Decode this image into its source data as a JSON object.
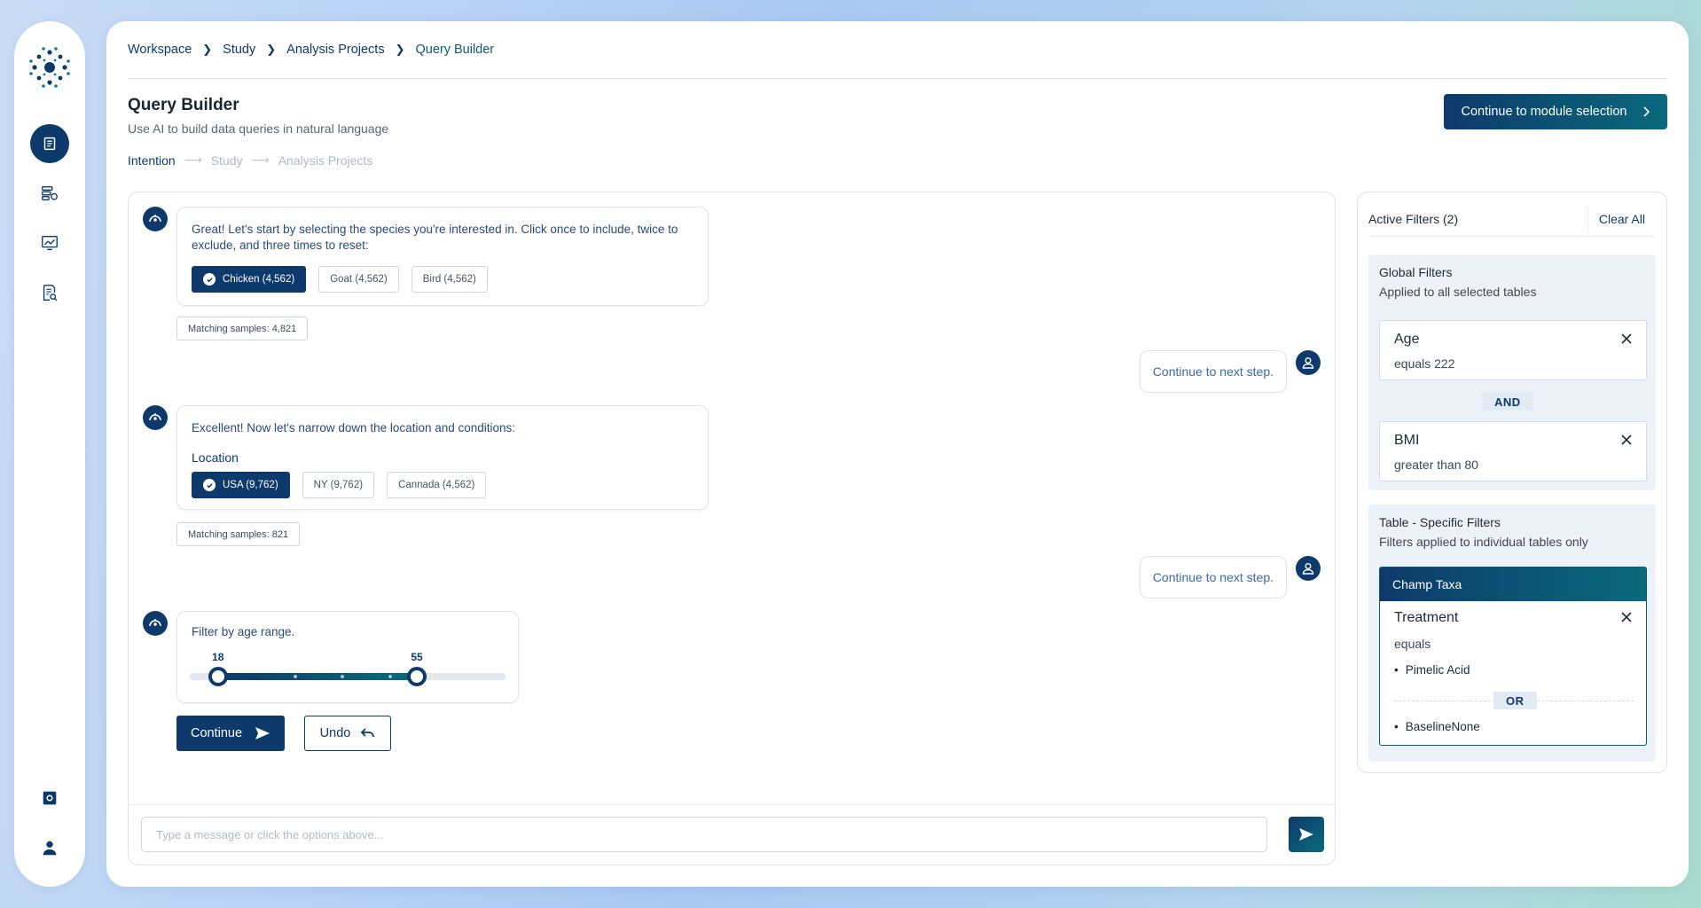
{
  "breadcrumb": [
    "Workspace",
    "Study",
    "Analysis Projects",
    "Query Builder"
  ],
  "header": {
    "title": "Query Builder",
    "subtitle": "Use AI to build data queries in natural language",
    "cta": "Continue to module selection"
  },
  "steps": [
    {
      "label": "Intention",
      "active": true
    },
    {
      "label": "Study",
      "active": false
    },
    {
      "label": "Analysis Projects",
      "active": false
    }
  ],
  "sidebar": {
    "items": [
      {
        "name": "dashboard-icon",
        "active": true
      },
      {
        "name": "database-settings-icon",
        "active": false
      },
      {
        "name": "analytics-monitor-icon",
        "active": false
      },
      {
        "name": "document-search-icon",
        "active": false
      }
    ],
    "bottom": [
      "settings-icon",
      "user-icon"
    ]
  },
  "chat": {
    "msg1": {
      "text": "Great! Let's start by selecting the species you're interested in. Click once to include, twice to exclude, and three times to reset:",
      "options": [
        {
          "label": "Chicken (4,562)",
          "selected": true
        },
        {
          "label": "Goat (4,562)",
          "selected": false
        },
        {
          "label": "Bird (4,562)",
          "selected": false
        }
      ],
      "matching": "Matching samples: 4,821"
    },
    "reply1": "Continue to next step.",
    "msg2": {
      "text": "Excellent! Now let's narrow down the location and conditions:",
      "section_label": "Location",
      "options": [
        {
          "label": "USA (9,762)",
          "selected": true
        },
        {
          "label": "NY (9,762)",
          "selected": false
        },
        {
          "label": "Cannada (4,562)",
          "selected": false
        }
      ],
      "matching": "Matching samples: 821"
    },
    "reply2": "Continue to next step.",
    "msg3": {
      "text": "Filter by age range.",
      "min": "18",
      "max": "55",
      "range_start_fraction": 0.09,
      "range_end_fraction": 0.72
    },
    "continue_label": "Continue",
    "undo_label": "Undo",
    "input_placeholder": "Type a message or click the options above..."
  },
  "filters": {
    "title": "Active Filters (2)",
    "clear": "Clear All",
    "global": {
      "title": "Global Filters",
      "subtitle": "Applied to all selected tables",
      "items": [
        {
          "name": "Age",
          "condition": "equals 222"
        },
        {
          "name": "BMI",
          "condition": "greater than 80"
        }
      ],
      "joiner": "AND"
    },
    "table": {
      "title": "Table - Specific Filters",
      "subtitle": "Filters applied to individual tables only",
      "table_name": "Champ Taxa",
      "filter_name": "Treatment",
      "condition": "equals",
      "values": [
        "Pimelic Acid",
        "BaselineNone"
      ],
      "joiner": "OR"
    }
  },
  "colors": {
    "primary": "#0d3a6b",
    "teal": "#0a6a7c",
    "text_blue": "#2b4a78"
  }
}
